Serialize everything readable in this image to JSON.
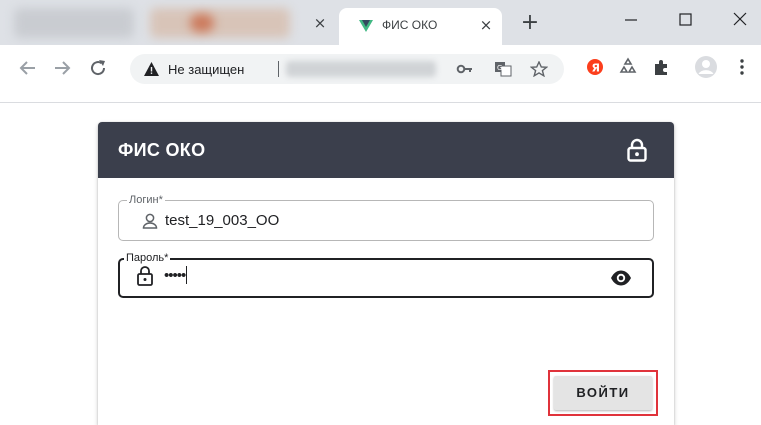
{
  "browser": {
    "active_tab_title": "ФИС ОКО",
    "tab_close_glyph": "×",
    "new_tab_glyph": "+",
    "address_bar": {
      "security_text": "Не защищен"
    }
  },
  "card": {
    "title": "ФИС ОКО",
    "login_field": {
      "label": "Логин*",
      "value": "test_19_003_OO"
    },
    "password_field": {
      "label": "Пароль*",
      "value": "•••••"
    },
    "submit_label": "ВОЙТИ"
  },
  "colors": {
    "header_bg": "#3b3f4c",
    "highlight": "#e0333b",
    "vue_green": "#41b883",
    "yandex_red": "#fc3f1d"
  },
  "icons": {
    "header": "lock-icon",
    "login": "user-icon",
    "password": "lock-icon",
    "toggle": "eye-icon"
  }
}
